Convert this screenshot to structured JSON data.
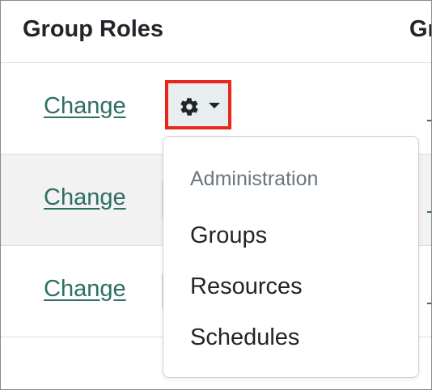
{
  "table": {
    "headers": [
      "Group Roles",
      "Gr"
    ],
    "rows": [
      {
        "action_label": "Change"
      },
      {
        "action_label": "Change"
      },
      {
        "action_label": "Change"
      }
    ]
  },
  "settings_button": {
    "icon": "gear-icon",
    "caret_icon": "caret-down-icon",
    "highlight_color": "#e8261b"
  },
  "dropdown_menu": {
    "header": "Administration",
    "items": [
      "Groups",
      "Resources",
      "Schedules"
    ]
  },
  "colors": {
    "link": "#2e6f63",
    "header_text": "#212529",
    "muted_text": "#6c757d",
    "striped_row": "#f2f2f2"
  }
}
